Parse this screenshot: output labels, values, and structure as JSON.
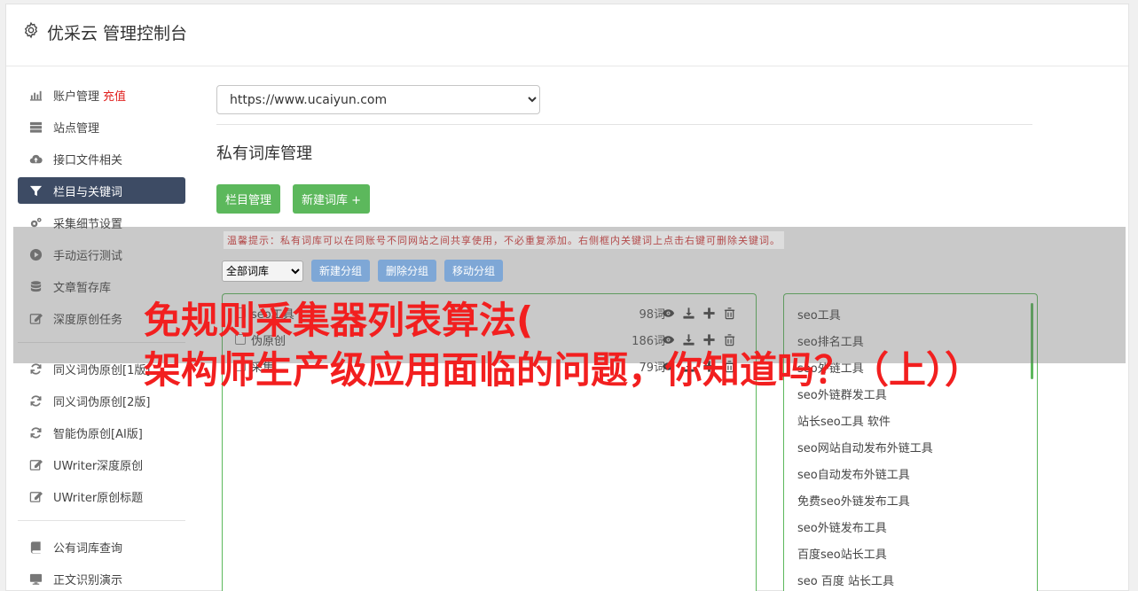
{
  "header": {
    "title": "优采云 管理控制台"
  },
  "sidebar": {
    "group1": [
      {
        "label": "账户管理",
        "extra": "充值"
      },
      {
        "label": "站点管理"
      },
      {
        "label": "接口文件相关"
      },
      {
        "label": "栏目与关键词"
      },
      {
        "label": "采集细节设置"
      },
      {
        "label": "手动运行测试"
      },
      {
        "label": "文章暂存库"
      },
      {
        "label": "深度原创任务"
      }
    ],
    "group2": [
      {
        "label": "同义词伪原创[1版]"
      },
      {
        "label": "同义词伪原创[2版]"
      },
      {
        "label": "智能伪原创[AI版]"
      },
      {
        "label": "UWriter深度原创"
      },
      {
        "label": "UWriter原创标题"
      }
    ],
    "group3": [
      {
        "label": "公有词库查询"
      },
      {
        "label": "正文识别演示"
      }
    ]
  },
  "main": {
    "site_select": {
      "value": "https://www.ucaiyun.com"
    },
    "section_title": "私有词库管理",
    "btn_category": "栏目管理",
    "btn_new_lib": "新建词库 +",
    "tip": "温馨提示：私有词库可以在同账号不同网站之间共享使用，不必重复添加。右侧框内关键词上点击右键可删除关键词。",
    "filter_select": "全部词库",
    "btn_new_group": "新建分组",
    "btn_delete_group": "删除分组",
    "btn_move_group": "移动分组",
    "libraries": [
      {
        "name": "seo工具",
        "count": "98词"
      },
      {
        "name": "伪原创",
        "count": "186词"
      },
      {
        "name": "采集",
        "count": "79词"
      }
    ],
    "keywords": [
      "seo工具",
      "seo排名工具",
      "seo外链工具",
      "seo外链群发工具",
      "站长seo工具 软件",
      "seo网站自动发布外链工具",
      "seo自动发布外链工具",
      "免费seo外链发布工具",
      "seo外链发布工具",
      "百度seo站长工具",
      "seo 百度 站长工具"
    ]
  },
  "watermark": {
    "line1": "免规则采集器列表算法(",
    "line2": "架构师生产级应用面临的问题，你知道吗？（上））"
  }
}
